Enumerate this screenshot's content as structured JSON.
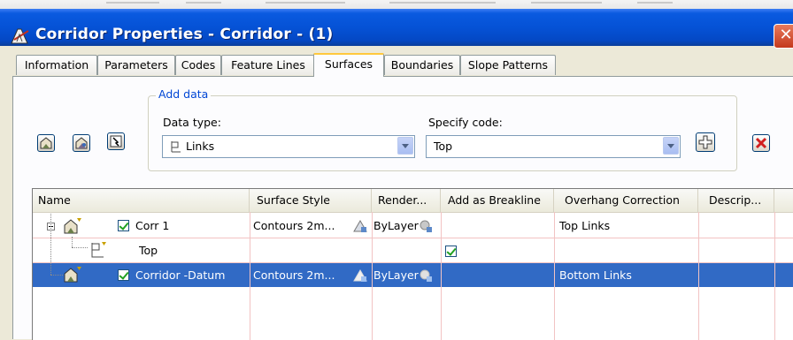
{
  "window": {
    "title": "Corridor Properties - Corridor - (1)",
    "close_glyph": "✕"
  },
  "tabs": [
    {
      "label": "Information",
      "active": false
    },
    {
      "label": "Parameters",
      "active": false
    },
    {
      "label": "Codes",
      "active": false
    },
    {
      "label": "Feature Lines",
      "active": false
    },
    {
      "label": "Surfaces",
      "active": true
    },
    {
      "label": "Boundaries",
      "active": false
    },
    {
      "label": "Slope Patterns",
      "active": false
    }
  ],
  "add_data": {
    "legend": "Add data",
    "data_type_label": "Data type:",
    "data_type_value": "Links",
    "specify_code_label": "Specify code:",
    "specify_code_value": "Top"
  },
  "toolbar": {
    "icons": [
      "create-surface-icon",
      "create-surface-from-data-icon",
      "surface-style-icon",
      "add-icon",
      "delete-icon"
    ]
  },
  "grid": {
    "columns": [
      "Name",
      "Surface Style",
      "Render...",
      "Add as Breakline",
      "Overhang Correction",
      "Descrip..."
    ],
    "rows": [
      {
        "name": "Corr 1",
        "checked": true,
        "surface_style": "Contours 2m...",
        "render": "ByLayer",
        "breakline": "",
        "overhang": "Top Links",
        "selected": false
      },
      {
        "name": "Top",
        "checked": null,
        "surface_style": "",
        "render": "",
        "breakline": "checked",
        "overhang": "",
        "selected": false
      },
      {
        "name": "Corridor -Datum",
        "checked": true,
        "surface_style": "Contours 2m...",
        "render": "ByLayer",
        "breakline": "",
        "overhang": "Bottom Links",
        "selected": true
      }
    ]
  },
  "colors": {
    "title_bar": "#0552d6",
    "selection": "#316ac5",
    "active_tab_highlight": "#ffc83c",
    "group_legend": "#0046d5"
  }
}
